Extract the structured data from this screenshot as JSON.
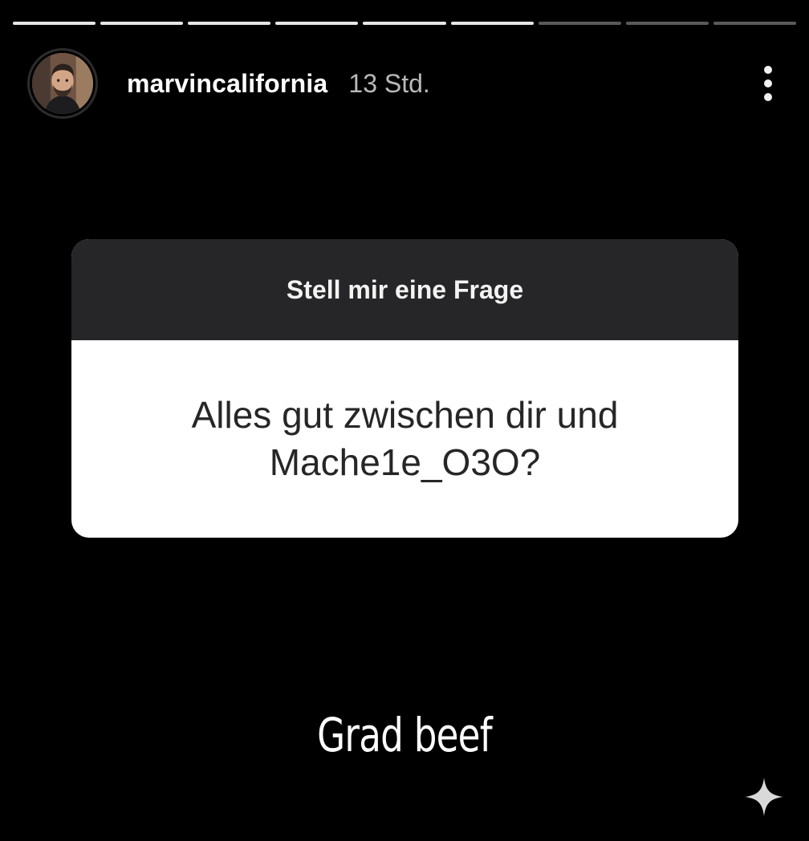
{
  "story": {
    "progress": {
      "total_segments": 9,
      "completed_segments": 6
    },
    "user": {
      "username": "marvincalifornia",
      "time_ago": "13 Std."
    }
  },
  "question_sticker": {
    "title": "Stell mir eine Frage",
    "question": "Alles gut zwischen dir und Mache1e_O3O?"
  },
  "answer_text": "Grad beef",
  "icons": {
    "more": "more-vertical-icon",
    "sparkle": "sparkle-icon"
  },
  "colors": {
    "background": "#000000",
    "card_header": "#262628",
    "card_body": "#ffffff"
  }
}
